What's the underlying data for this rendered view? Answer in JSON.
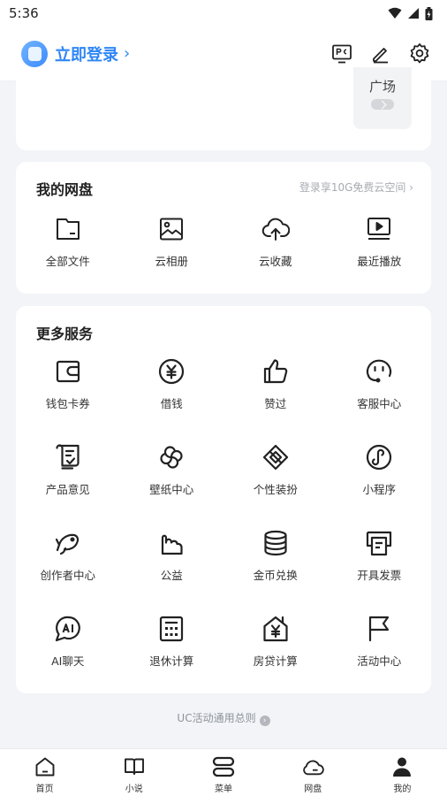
{
  "status": {
    "time": "5:36"
  },
  "header": {
    "login_label": "立即登录",
    "login_chevron": "›",
    "actions": [
      "pc-icon",
      "edit-icon",
      "settings-icon"
    ]
  },
  "top_card": {
    "plaza_label": "广场"
  },
  "netdisk": {
    "title": "我的网盘",
    "promo": "登录享10G免费云空间 ›",
    "items": [
      {
        "label": "全部文件",
        "icon": "folder-icon"
      },
      {
        "label": "云相册",
        "icon": "image-icon"
      },
      {
        "label": "云收藏",
        "icon": "cloud-upload-icon"
      },
      {
        "label": "最近播放",
        "icon": "play-screen-icon"
      }
    ]
  },
  "services": {
    "title": "更多服务",
    "items": [
      {
        "label": "钱包卡券",
        "icon": "wallet-icon"
      },
      {
        "label": "借钱",
        "icon": "yen-coin-icon"
      },
      {
        "label": "赞过",
        "icon": "thumbs-up-icon"
      },
      {
        "label": "客服中心",
        "icon": "headset-icon"
      },
      {
        "label": "产品意见",
        "icon": "feedback-doc-icon"
      },
      {
        "label": "壁纸中心",
        "icon": "pinwheel-icon"
      },
      {
        "label": "个性装扮",
        "icon": "interlock-icon"
      },
      {
        "label": "小程序",
        "icon": "mini-program-icon"
      },
      {
        "label": "创作者中心",
        "icon": "creator-fish-icon"
      },
      {
        "label": "公益",
        "icon": "charity-hand-icon"
      },
      {
        "label": "金币兑换",
        "icon": "coin-stack-icon"
      },
      {
        "label": "开具发票",
        "icon": "invoice-printer-icon"
      },
      {
        "label": "AI聊天",
        "icon": "ai-chat-icon"
      },
      {
        "label": "退休计算",
        "icon": "calculator-icon"
      },
      {
        "label": "房贷计算",
        "icon": "house-yen-icon"
      },
      {
        "label": "活动中心",
        "icon": "flag-icon"
      }
    ]
  },
  "rules_link": "UC活动通用总则",
  "tabs": [
    {
      "label": "首页",
      "icon": "home-icon"
    },
    {
      "label": "小说",
      "icon": "book-icon"
    },
    {
      "label": "菜单",
      "icon": "menu-icon"
    },
    {
      "label": "网盘",
      "icon": "cloud-icon"
    },
    {
      "label": "我的",
      "icon": "profile-icon"
    }
  ],
  "colors": {
    "accent": "#2f86f6",
    "icon_stroke": "#222222",
    "background": "#f2f4f7"
  }
}
